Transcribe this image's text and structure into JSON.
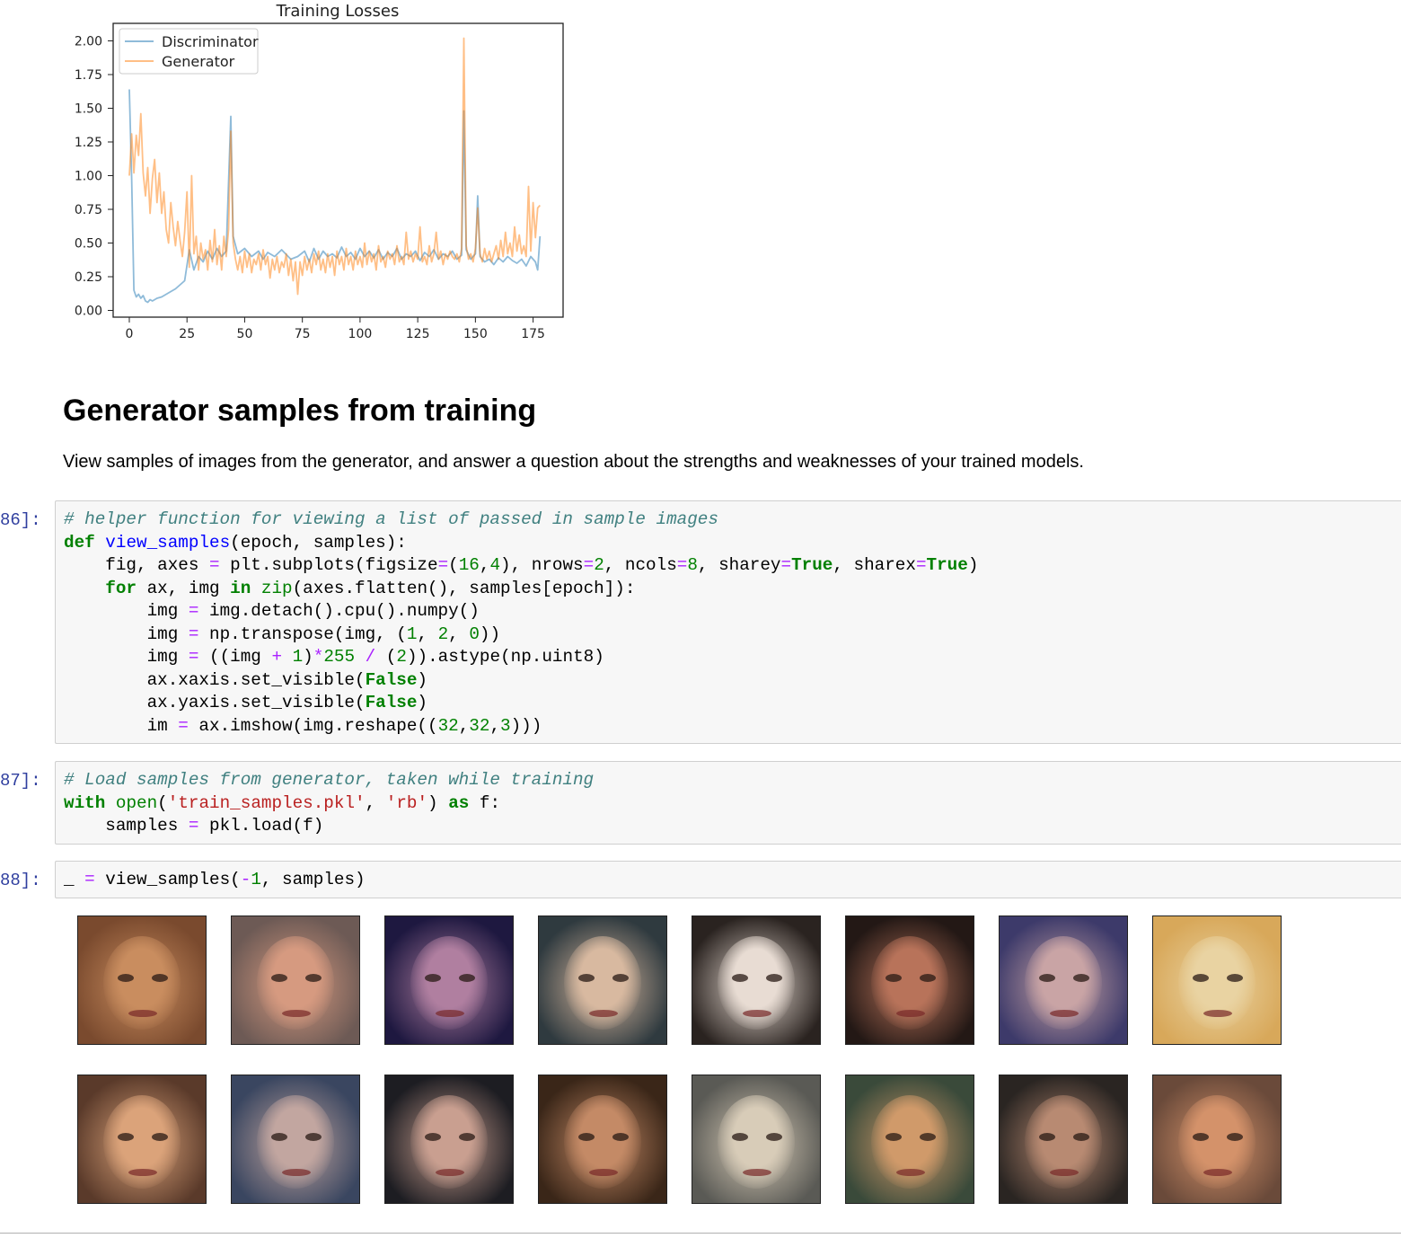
{
  "chart_data": {
    "type": "line",
    "title": "Training Losses",
    "xlabel": "",
    "ylabel": "",
    "xlim": [
      -7,
      188
    ],
    "ylim": [
      -0.05,
      2.13
    ],
    "xticks": [
      0,
      25,
      50,
      75,
      100,
      125,
      150,
      175
    ],
    "yticks": [
      0.0,
      0.25,
      0.5,
      0.75,
      1.0,
      1.25,
      1.5,
      1.75,
      2.0
    ],
    "ytick_labels": [
      "0.00",
      "0.25",
      "0.50",
      "0.75",
      "1.00",
      "1.25",
      "1.50",
      "1.75",
      "2.00"
    ],
    "legend": "top-left",
    "grid": false,
    "series": [
      {
        "name": "Discriminator",
        "color": "#1f77b4",
        "points": [
          [
            0,
            1.64
          ],
          [
            1,
            0.98
          ],
          [
            2,
            0.15
          ],
          [
            3,
            0.1
          ],
          [
            4,
            0.12
          ],
          [
            5,
            0.09
          ],
          [
            6,
            0.11
          ],
          [
            7,
            0.07
          ],
          [
            8,
            0.06
          ],
          [
            9,
            0.08
          ],
          [
            10,
            0.07
          ],
          [
            12,
            0.09
          ],
          [
            14,
            0.1
          ],
          [
            16,
            0.12
          ],
          [
            18,
            0.14
          ],
          [
            20,
            0.16
          ],
          [
            22,
            0.19
          ],
          [
            24,
            0.22
          ],
          [
            26,
            0.45
          ],
          [
            28,
            0.3
          ],
          [
            30,
            0.4
          ],
          [
            32,
            0.36
          ],
          [
            34,
            0.44
          ],
          [
            36,
            0.38
          ],
          [
            38,
            0.46
          ],
          [
            40,
            0.4
          ],
          [
            42,
            0.44
          ],
          [
            44,
            1.44
          ],
          [
            45,
            0.55
          ],
          [
            47,
            0.42
          ],
          [
            50,
            0.46
          ],
          [
            53,
            0.4
          ],
          [
            56,
            0.44
          ],
          [
            58,
            0.38
          ],
          [
            60,
            0.43
          ],
          [
            63,
            0.4
          ],
          [
            66,
            0.45
          ],
          [
            70,
            0.38
          ],
          [
            73,
            0.4
          ],
          [
            76,
            0.44
          ],
          [
            78,
            0.36
          ],
          [
            80,
            0.46
          ],
          [
            82,
            0.38
          ],
          [
            84,
            0.44
          ],
          [
            86,
            0.4
          ],
          [
            88,
            0.42
          ],
          [
            90,
            0.39
          ],
          [
            92,
            0.47
          ],
          [
            94,
            0.4
          ],
          [
            96,
            0.43
          ],
          [
            98,
            0.38
          ],
          [
            100,
            0.46
          ],
          [
            102,
            0.4
          ],
          [
            104,
            0.44
          ],
          [
            106,
            0.39
          ],
          [
            108,
            0.45
          ],
          [
            110,
            0.38
          ],
          [
            112,
            0.43
          ],
          [
            114,
            0.4
          ],
          [
            116,
            0.46
          ],
          [
            118,
            0.38
          ],
          [
            120,
            0.42
          ],
          [
            122,
            0.4
          ],
          [
            124,
            0.44
          ],
          [
            126,
            0.37
          ],
          [
            128,
            0.43
          ],
          [
            130,
            0.4
          ],
          [
            132,
            0.45
          ],
          [
            134,
            0.38
          ],
          [
            136,
            0.42
          ],
          [
            138,
            0.4
          ],
          [
            140,
            0.44
          ],
          [
            142,
            0.38
          ],
          [
            144,
            0.41
          ],
          [
            145,
            1.48
          ],
          [
            146,
            0.45
          ],
          [
            148,
            0.38
          ],
          [
            150,
            0.42
          ],
          [
            151,
            0.85
          ],
          [
            152,
            0.4
          ],
          [
            154,
            0.36
          ],
          [
            156,
            0.38
          ],
          [
            158,
            0.34
          ],
          [
            160,
            0.39
          ],
          [
            162,
            0.36
          ],
          [
            164,
            0.4
          ],
          [
            166,
            0.37
          ],
          [
            168,
            0.35
          ],
          [
            170,
            0.38
          ],
          [
            172,
            0.33
          ],
          [
            174,
            0.4
          ],
          [
            176,
            0.36
          ],
          [
            177,
            0.3
          ],
          [
            178,
            0.55
          ]
        ]
      },
      {
        "name": "Generator",
        "color": "#ff7f0e",
        "points": [
          [
            0,
            1.0
          ],
          [
            1,
            1.31
          ],
          [
            2,
            1.02
          ],
          [
            3,
            1.3
          ],
          [
            4,
            1.15
          ],
          [
            5,
            1.46
          ],
          [
            6,
            1.02
          ],
          [
            7,
            0.85
          ],
          [
            8,
            1.06
          ],
          [
            9,
            0.72
          ],
          [
            10,
            0.98
          ],
          [
            11,
            1.12
          ],
          [
            12,
            0.8
          ],
          [
            13,
            1.02
          ],
          [
            14,
            0.72
          ],
          [
            15,
            0.88
          ],
          [
            16,
            0.6
          ],
          [
            17,
            0.5
          ],
          [
            18,
            0.8
          ],
          [
            19,
            0.62
          ],
          [
            20,
            0.48
          ],
          [
            21,
            0.66
          ],
          [
            22,
            0.52
          ],
          [
            23,
            0.4
          ],
          [
            24,
            0.58
          ],
          [
            25,
            0.88
          ],
          [
            26,
            0.32
          ],
          [
            27,
            1.0
          ],
          [
            28,
            0.42
          ],
          [
            29,
            0.55
          ],
          [
            30,
            0.3
          ],
          [
            31,
            0.5
          ],
          [
            32,
            0.38
          ],
          [
            33,
            0.45
          ],
          [
            34,
            0.3
          ],
          [
            35,
            0.52
          ],
          [
            36,
            0.36
          ],
          [
            37,
            0.6
          ],
          [
            38,
            0.34
          ],
          [
            39,
            0.48
          ],
          [
            40,
            0.3
          ],
          [
            41,
            0.55
          ],
          [
            42,
            0.4
          ],
          [
            43,
            0.6
          ],
          [
            44,
            1.33
          ],
          [
            45,
            0.5
          ],
          [
            46,
            0.38
          ],
          [
            47,
            0.3
          ],
          [
            48,
            0.4
          ],
          [
            49,
            0.28
          ],
          [
            50,
            0.44
          ],
          [
            51,
            0.32
          ],
          [
            52,
            0.42
          ],
          [
            53,
            0.28
          ],
          [
            54,
            0.38
          ],
          [
            55,
            0.34
          ],
          [
            56,
            0.42
          ],
          [
            57,
            0.3
          ],
          [
            58,
            0.45
          ],
          [
            59,
            0.34
          ],
          [
            60,
            0.4
          ],
          [
            61,
            0.24
          ],
          [
            62,
            0.38
          ],
          [
            63,
            0.3
          ],
          [
            64,
            0.4
          ],
          [
            65,
            0.28
          ],
          [
            66,
            0.36
          ],
          [
            67,
            0.32
          ],
          [
            68,
            0.42
          ],
          [
            69,
            0.26
          ],
          [
            70,
            0.38
          ],
          [
            71,
            0.22
          ],
          [
            72,
            0.36
          ],
          [
            73,
            0.12
          ],
          [
            74,
            0.36
          ],
          [
            75,
            0.26
          ],
          [
            76,
            0.4
          ],
          [
            77,
            0.3
          ],
          [
            78,
            0.38
          ],
          [
            79,
            0.28
          ],
          [
            80,
            0.42
          ],
          [
            81,
            0.34
          ],
          [
            82,
            0.44
          ],
          [
            83,
            0.3
          ],
          [
            84,
            0.38
          ],
          [
            85,
            0.28
          ],
          [
            86,
            0.42
          ],
          [
            87,
            0.32
          ],
          [
            88,
            0.4
          ],
          [
            89,
            0.26
          ],
          [
            90,
            0.44
          ],
          [
            91,
            0.34
          ],
          [
            92,
            0.4
          ],
          [
            93,
            0.3
          ],
          [
            94,
            0.46
          ],
          [
            95,
            0.34
          ],
          [
            96,
            0.4
          ],
          [
            97,
            0.3
          ],
          [
            98,
            0.44
          ],
          [
            99,
            0.34
          ],
          [
            100,
            0.4
          ],
          [
            101,
            0.32
          ],
          [
            102,
            0.5
          ],
          [
            103,
            0.34
          ],
          [
            104,
            0.44
          ],
          [
            105,
            0.36
          ],
          [
            106,
            0.42
          ],
          [
            107,
            0.3
          ],
          [
            108,
            0.48
          ],
          [
            109,
            0.36
          ],
          [
            110,
            0.4
          ],
          [
            111,
            0.32
          ],
          [
            112,
            0.44
          ],
          [
            113,
            0.38
          ],
          [
            114,
            0.42
          ],
          [
            115,
            0.34
          ],
          [
            116,
            0.48
          ],
          [
            117,
            0.36
          ],
          [
            118,
            0.4
          ],
          [
            119,
            0.34
          ],
          [
            120,
            0.58
          ],
          [
            121,
            0.38
          ],
          [
            122,
            0.44
          ],
          [
            123,
            0.36
          ],
          [
            124,
            0.42
          ],
          [
            125,
            0.38
          ],
          [
            126,
            0.62
          ],
          [
            127,
            0.36
          ],
          [
            128,
            0.4
          ],
          [
            129,
            0.34
          ],
          [
            130,
            0.48
          ],
          [
            131,
            0.36
          ],
          [
            132,
            0.42
          ],
          [
            133,
            0.58
          ],
          [
            134,
            0.38
          ],
          [
            135,
            0.44
          ],
          [
            136,
            0.34
          ],
          [
            137,
            0.42
          ],
          [
            138,
            0.38
          ],
          [
            139,
            0.44
          ],
          [
            140,
            0.4
          ],
          [
            141,
            0.38
          ],
          [
            142,
            0.42
          ],
          [
            143,
            0.36
          ],
          [
            144,
            0.46
          ],
          [
            145,
            2.02
          ],
          [
            146,
            0.48
          ],
          [
            147,
            0.38
          ],
          [
            148,
            0.42
          ],
          [
            149,
            0.36
          ],
          [
            150,
            0.46
          ],
          [
            151,
            0.76
          ],
          [
            152,
            0.42
          ],
          [
            153,
            0.36
          ],
          [
            154,
            0.46
          ],
          [
            155,
            0.38
          ],
          [
            156,
            0.44
          ],
          [
            157,
            0.36
          ],
          [
            158,
            0.42
          ],
          [
            159,
            0.48
          ],
          [
            160,
            0.38
          ],
          [
            161,
            0.52
          ],
          [
            162,
            0.4
          ],
          [
            163,
            0.58
          ],
          [
            164,
            0.42
          ],
          [
            165,
            0.5
          ],
          [
            166,
            0.4
          ],
          [
            167,
            0.62
          ],
          [
            168,
            0.44
          ],
          [
            169,
            0.56
          ],
          [
            170,
            0.42
          ],
          [
            171,
            0.48
          ],
          [
            172,
            0.4
          ],
          [
            173,
            0.92
          ],
          [
            174,
            0.44
          ],
          [
            175,
            0.8
          ],
          [
            176,
            0.54
          ],
          [
            177,
            0.76
          ],
          [
            178,
            0.78
          ]
        ]
      }
    ]
  },
  "markdown": {
    "heading": "Generator samples from training",
    "paragraph": "View samples of images from the generator, and answer a question about the strengths and weaknesses of your trained models."
  },
  "cells": [
    {
      "prompt": "86]:"
    },
    {
      "prompt": "87]:"
    },
    {
      "prompt": "88]:"
    }
  ],
  "output": {
    "sample_images": [
      {
        "name": "sample-face-1",
        "bg": "#7a4a2e",
        "skin": "#c98d5f"
      },
      {
        "name": "sample-face-2",
        "bg": "#6d5a55",
        "skin": "#d69a80"
      },
      {
        "name": "sample-face-3",
        "bg": "#1e1840",
        "skin": "#b07fa0"
      },
      {
        "name": "sample-face-4",
        "bg": "#2f3a3f",
        "skin": "#d8b9a0"
      },
      {
        "name": "sample-face-5",
        "bg": "#2a2320",
        "skin": "#e8dcd3"
      },
      {
        "name": "sample-face-6",
        "bg": "#231815",
        "skin": "#b8735a"
      },
      {
        "name": "sample-face-7",
        "bg": "#3d3a6a",
        "skin": "#c9a4a5"
      },
      {
        "name": "sample-face-8",
        "bg": "#d8a85a",
        "skin": "#e9d3a2"
      },
      {
        "name": "sample-face-9",
        "bg": "#5a3a2a",
        "skin": "#dba37a"
      },
      {
        "name": "sample-face-10",
        "bg": "#3a4660",
        "skin": "#c2a6a0"
      },
      {
        "name": "sample-face-11",
        "bg": "#1d1d22",
        "skin": "#c99f90"
      },
      {
        "name": "sample-face-12",
        "bg": "#3a2618",
        "skin": "#c48a66"
      },
      {
        "name": "sample-face-13",
        "bg": "#5a5a55",
        "skin": "#d8ccb8"
      },
      {
        "name": "sample-face-14",
        "bg": "#3a4a3a",
        "skin": "#d09a6a"
      },
      {
        "name": "sample-face-15",
        "bg": "#2a2522",
        "skin": "#b88a72"
      },
      {
        "name": "sample-face-16",
        "bg": "#6a4a3a",
        "skin": "#d4926a"
      }
    ]
  }
}
